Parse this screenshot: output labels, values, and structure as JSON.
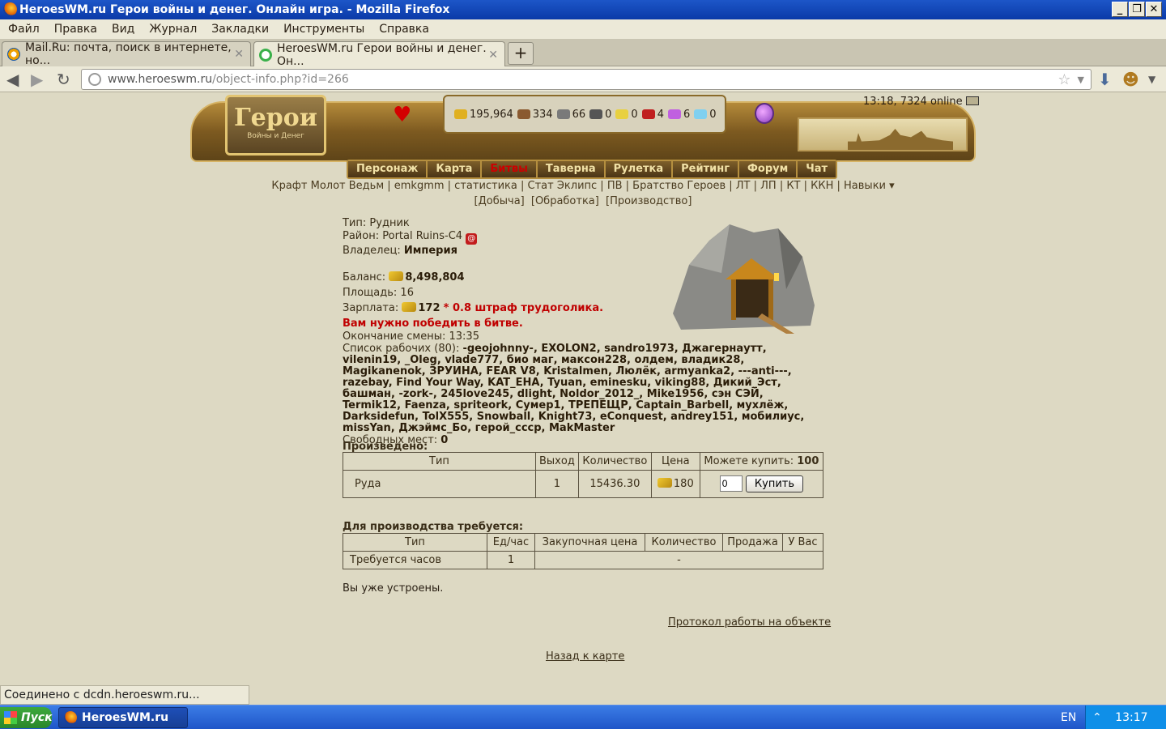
{
  "window": {
    "title": "HeroesWM.ru Герои войны и денег. Онлайн игра. - Mozilla Firefox",
    "minimize": "_",
    "restore": "❐",
    "close": "✕"
  },
  "menu": [
    "Файл",
    "Правка",
    "Вид",
    "Журнал",
    "Закладки",
    "Инструменты",
    "Справка"
  ],
  "tabs": [
    {
      "label": "Mail.Ru: почта, поиск в интернете, но...",
      "close": "✕"
    },
    {
      "label": "HeroesWM.ru Герои войны и денег. Он...",
      "close": "✕"
    }
  ],
  "newtab": "+",
  "url": {
    "host": "www.heroeswm.ru",
    "path": "/object-info.php?id=266"
  },
  "header": {
    "logo_big": "Герои",
    "logo_small": "Войны и Денег",
    "resources": [
      "195,964",
      "334",
      "66",
      "0",
      "0",
      "4",
      "6",
      "0"
    ],
    "resource_colors": [
      "#e0b020",
      "#8a5a30",
      "#7a7a7a",
      "#555555",
      "#e8d040",
      "#c02020",
      "#c060e0",
      "#80d0f0"
    ],
    "clock": "13:18, 7324 online"
  },
  "gamenav": [
    "Персонаж",
    "Карта",
    "Битвы",
    "Таверна",
    "Рулетка",
    "Рейтинг",
    "Форум",
    "Чат"
  ],
  "subnav": "Крафт Молот Ведьм | emkgmm | статистика | Стат Эклипс | ПВ | Братство Героев | ЛТ | ЛП | КТ | ККН |  Навыки ▾",
  "subnav2": [
    "[Добыча]",
    "[Обработка]",
    "[Производство]"
  ],
  "info": {
    "type_label": "Тип:",
    "type_value": "Рудник",
    "district_label": "Район:",
    "district_value": "Portal Ruins-C4",
    "at": "@",
    "owner_label": "Владелец:",
    "owner_value": "Империя",
    "balance_label": "Баланс:",
    "balance_value": "8,498,804",
    "area_label": "Площадь:",
    "area_value": "16",
    "salary_label": "Зарплата:",
    "salary_value": "172",
    "salary_penalty": "* 0.8 штраф трудоголика.",
    "must_win": "Вам нужно победить в битве.",
    "shift_label": "Окончание смены:",
    "shift_value": "13:35",
    "workers_label": "Список рабочих (80):",
    "workers": "-geojohnny-, EXOLON2, sandro1973, Джагернаутт, vilenin19, _Oleg, vlade777, био маг, максон228, олдем, владик28, Magikanenok, ЗРУИНА, FEAR V8, Kristalmen, Люлёк, armyanka2, ---anti---, razebay, Find Your Way, KAT_EHA, Tyuan, eminesku, viking88, Дикий_Эст, башман, -zork-, 245love245, dlight, Noldor_2012_, Mike1956, сэн СЭЙ, Termik12, Faenza, spriteork, Сумер1, ТРЕПЕЩР, Captain_Barbell, мухлёж, Darksidefun, TolX555, Snowball, Knight73, eConquest, andrey151, мобилиус, missYan, Джэймс_Бо, герой_ссср, MakMaster",
    "free_label": "Свободных мест:",
    "free_value": "0"
  },
  "produced": {
    "title": "Произведено:",
    "headers": [
      "Тип",
      "Выход",
      "Количество",
      "Цена",
      "Можете купить:"
    ],
    "can_buy": "100",
    "row": {
      "type": "Руда",
      "output": "1",
      "qty": "15436.30",
      "price": "180",
      "input": "0",
      "buy": "Купить"
    }
  },
  "required": {
    "title": "Для производства требуется:",
    "headers": [
      "Тип",
      "Ед/час",
      "Закупочная цена",
      "Количество",
      "Продажа",
      "У Вас"
    ],
    "row": {
      "type": "Требуется часов",
      "per_hour": "1",
      "dash": "-"
    }
  },
  "employed": "Вы уже устроены.",
  "protocol": "Протокол работы на объекте",
  "back": "Назад к карте",
  "status": "Соединено с dcdn.heroeswm.ru...",
  "taskbar": {
    "start": "Пуск",
    "task": "HeroesWM.ru Ге...",
    "lang": "EN",
    "tray_arrow": "⌃",
    "time": "13:17"
  }
}
